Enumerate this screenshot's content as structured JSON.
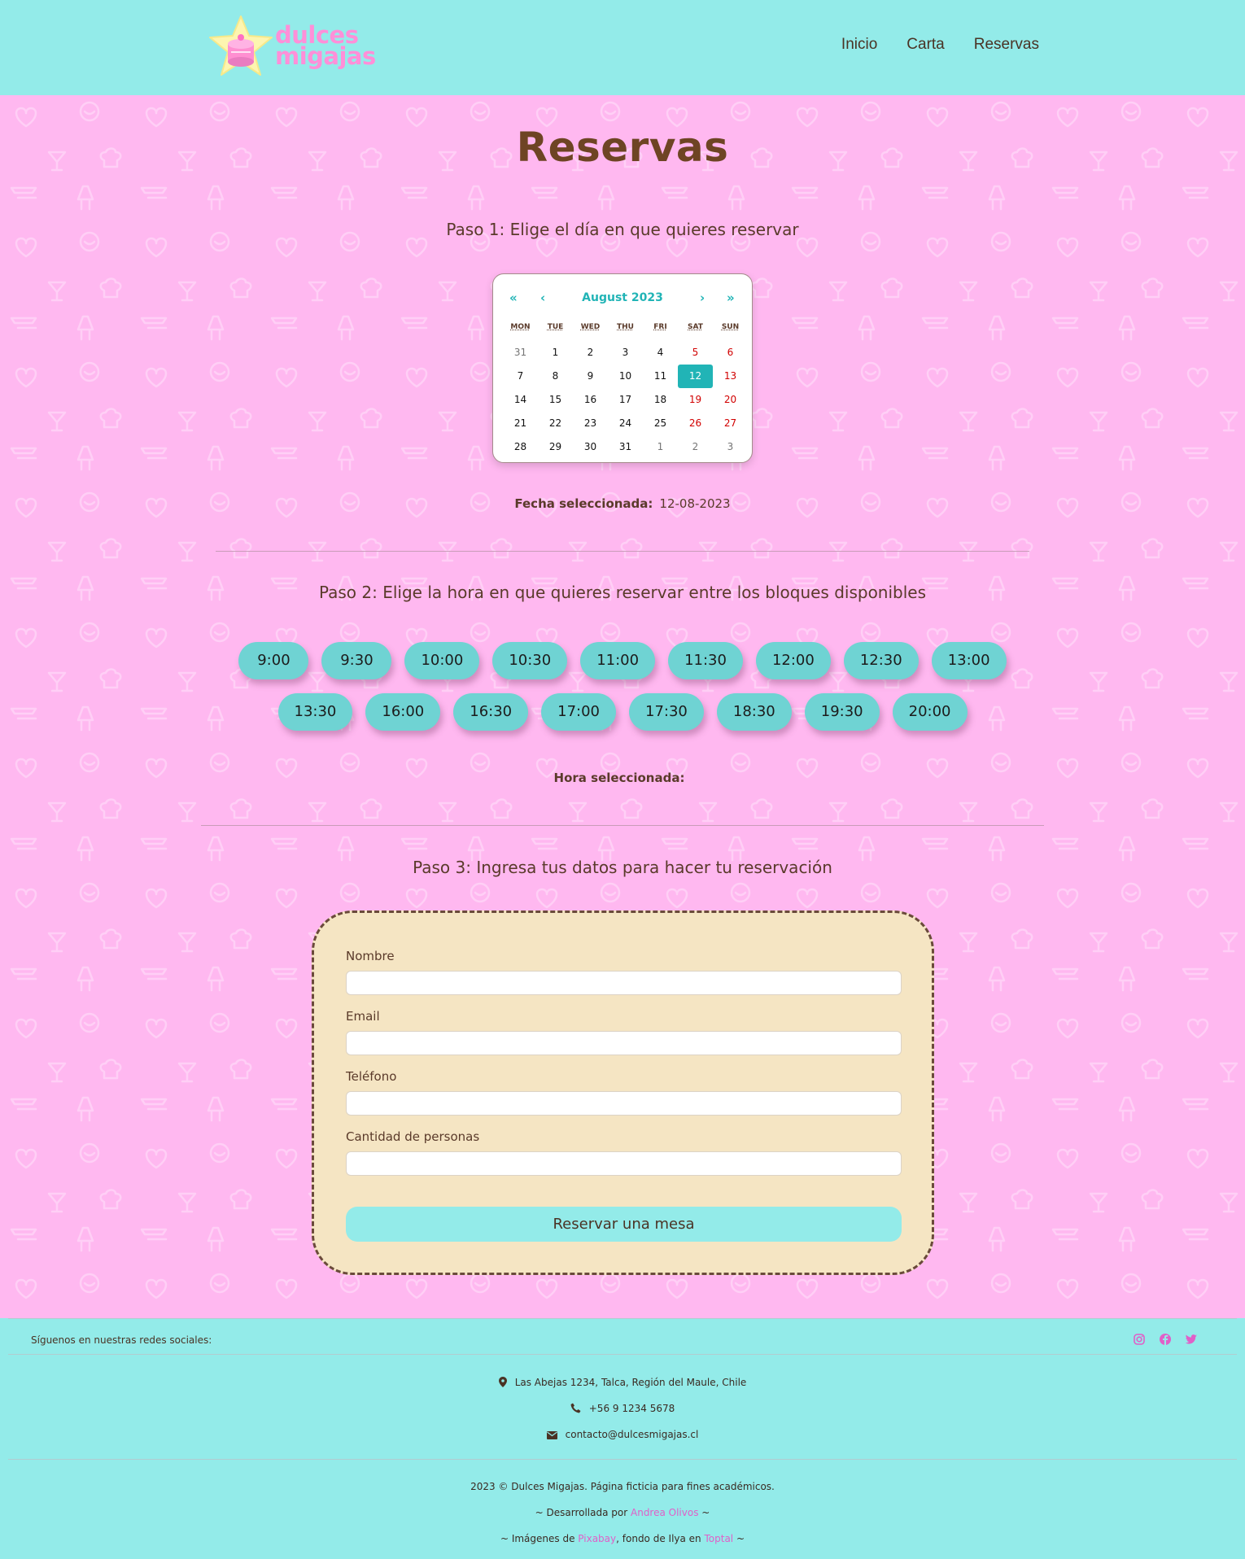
{
  "header": {
    "logo_line1": "dulces",
    "logo_line2": "migajas",
    "nav": [
      "Inicio",
      "Carta",
      "Reservas"
    ]
  },
  "page_title": "Reservas",
  "step1": {
    "title": "Paso 1: Elige el día en que quieres reservar",
    "calendar": {
      "month": "August 2023",
      "prev_year": "«",
      "prev_month": "‹",
      "next_month": "›",
      "next_year": "»",
      "weekdays": [
        "MON",
        "TUE",
        "WED",
        "THU",
        "FRI",
        "SAT",
        "SUN"
      ],
      "days": [
        "31",
        "1",
        "2",
        "3",
        "4",
        "5",
        "6",
        "7",
        "8",
        "9",
        "10",
        "11",
        "12",
        "13",
        "14",
        "15",
        "16",
        "17",
        "18",
        "19",
        "20",
        "21",
        "22",
        "23",
        "24",
        "25",
        "26",
        "27",
        "28",
        "29",
        "30",
        "31",
        "1",
        "2",
        "3"
      ],
      "selected_day": "12"
    },
    "selected_label": "Fecha seleccionada:",
    "selected_value": "12-08-2023"
  },
  "step2": {
    "title": "Paso 2: Elige la hora en que quieres reservar entre los bloques disponibles",
    "slots_row1": [
      "9:00",
      "9:30",
      "10:00",
      "10:30",
      "11:00",
      "11:30",
      "12:00",
      "12:30",
      "13:00"
    ],
    "slots_row2": [
      "13:30",
      "16:00",
      "16:30",
      "17:00",
      "17:30",
      "18:30",
      "19:30",
      "20:00"
    ],
    "selected_label": "Hora seleccionada:",
    "selected_value": ""
  },
  "step3": {
    "title": "Paso 3: Ingresa tus datos para hacer tu reservación",
    "fields": [
      {
        "label": "Nombre",
        "value": ""
      },
      {
        "label": "Email",
        "value": ""
      },
      {
        "label": "Teléfono",
        "value": ""
      },
      {
        "label": "Cantidad de personas",
        "value": ""
      }
    ],
    "submit": "Reservar una mesa"
  },
  "footer": {
    "social_label": "Síguenos en nuestras redes sociales:",
    "socials": [
      "instagram-icon",
      "facebook-icon",
      "twitter-icon"
    ],
    "address": "Las Abejas 1234, Talca, Región del Maule, Chile",
    "phone": "+56 9 1234 5678",
    "email": "contacto@dulcesmigajas.cl",
    "copyright": "2023 © Dulces Migajas. Página ficticia para fines académicos.",
    "dev_prefix": "~ Desarrollada por",
    "dev_name": "Andrea Olivos",
    "dev_suffix": "~",
    "img_prefix": "~ Imágenes de",
    "img_link1": "Pixabay",
    "img_mid": ", fondo de Ilya en",
    "img_link2": "Toptal",
    "img_suffix": "~"
  },
  "colors": {
    "header_bg": "#93ebe9",
    "page_bg": "#ffb8f0",
    "accent": "#21b4b6",
    "slot_bg": "#6fd3d3",
    "form_bg": "#f5e5c3",
    "link": "#e060c8",
    "brown": "#6e4424"
  }
}
